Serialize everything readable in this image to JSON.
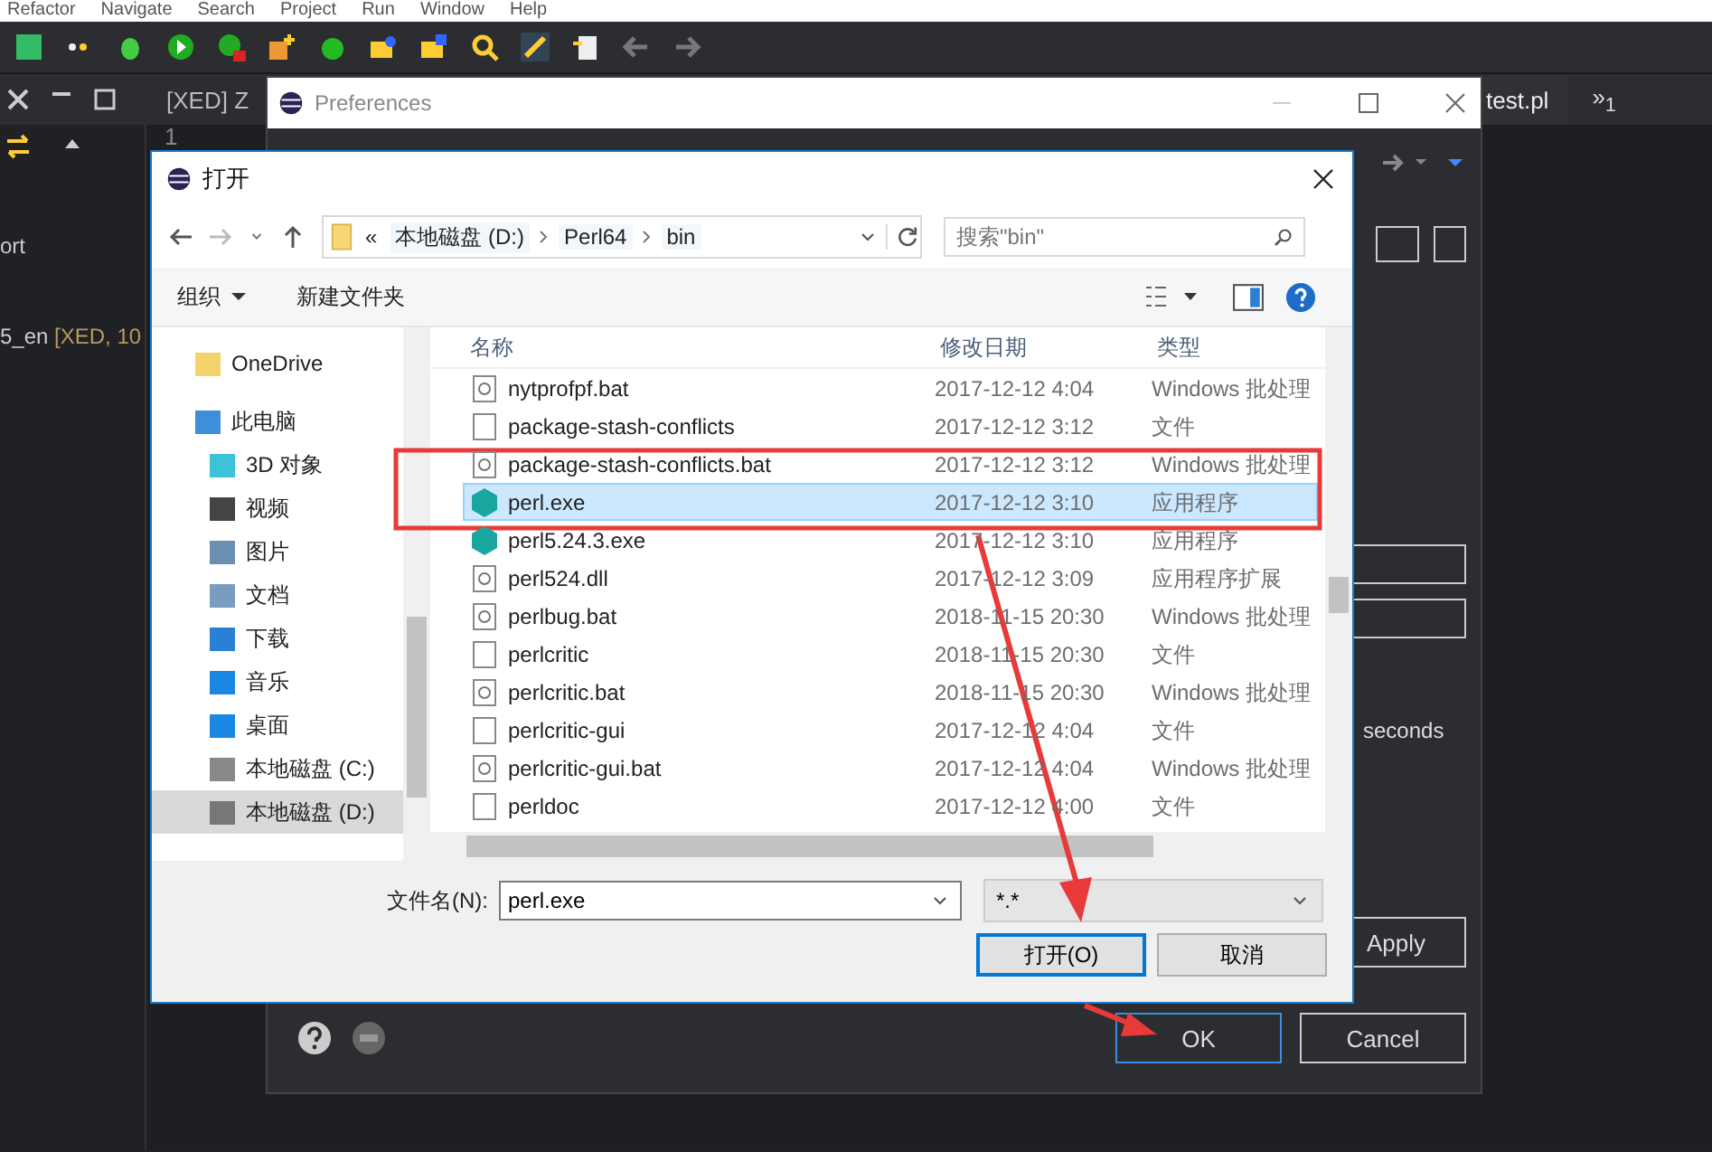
{
  "menu_bar": [
    "Refactor",
    "Navigate",
    "Search",
    "Project",
    "Run",
    "Window",
    "Help"
  ],
  "editor_tabs": [
    {
      "label": "[XED] Z",
      "selected": false
    },
    {
      "label": "test.pl",
      "selected": true
    }
  ],
  "overflow_tab": {
    "symbol": "»",
    "count": "1"
  },
  "outline": [
    {
      "text": "ort"
    },
    {
      "text": "5_en",
      "tag": "[XED, 10"
    }
  ],
  "line_number": "1",
  "preferences": {
    "title": "Preferences",
    "seconds_label": "seconds",
    "buttons": [
      {
        "label": "Apply",
        "default": false
      },
      {
        "label": "OK",
        "default": true
      },
      {
        "label": "Cancel",
        "default": false
      }
    ]
  },
  "open_dialog": {
    "title": "打开",
    "breadcrumb": {
      "overflow": "«",
      "segments": [
        "本地磁盘 (D:)",
        "Perl64",
        "bin"
      ]
    },
    "search": {
      "placeholder": "搜索\"bin\""
    },
    "toolbar": [
      {
        "label": "组织",
        "dropdown": true
      },
      {
        "label": "新建文件夹",
        "dropdown": false
      }
    ],
    "nav": [
      {
        "label": "OneDrive",
        "kind": "folder",
        "selected": false
      },
      {
        "label": "此电脑",
        "kind": "pc",
        "selected": false,
        "children": [
          {
            "label": "3D 对象",
            "kind": "cube",
            "selected": false
          },
          {
            "label": "视频",
            "kind": "video",
            "selected": false
          },
          {
            "label": "图片",
            "kind": "picture",
            "selected": false
          },
          {
            "label": "文档",
            "kind": "document",
            "selected": false
          },
          {
            "label": "下载",
            "kind": "download",
            "selected": false
          },
          {
            "label": "音乐",
            "kind": "music",
            "selected": false
          },
          {
            "label": "桌面",
            "kind": "desktop",
            "selected": false
          },
          {
            "label": "本地磁盘 (C:)",
            "kind": "drive-c",
            "selected": false
          },
          {
            "label": "本地磁盘 (D:)",
            "kind": "drive",
            "selected": true
          }
        ]
      }
    ],
    "columns": [
      "名称",
      "修改日期",
      "类型"
    ],
    "rows": [
      {
        "name": "nytprofpf.bat",
        "date": "2017-12-12 4:04",
        "type": "Windows 批处理",
        "kind": "bat",
        "selected": false
      },
      {
        "name": "package-stash-conflicts",
        "date": "2017-12-12 3:12",
        "type": "文件",
        "kind": "file",
        "selected": false
      },
      {
        "name": "package-stash-conflicts.bat",
        "date": "2017-12-12 3:12",
        "type": "Windows 批处理",
        "kind": "bat",
        "selected": false
      },
      {
        "name": "perl.exe",
        "date": "2017-12-12 3:10",
        "type": "应用程序",
        "kind": "exe",
        "selected": true
      },
      {
        "name": "perl5.24.3.exe",
        "date": "2017-12-12 3:10",
        "type": "应用程序",
        "kind": "exe",
        "selected": false
      },
      {
        "name": "perl524.dll",
        "date": "2017-12-12 3:09",
        "type": "应用程序扩展",
        "kind": "dll",
        "selected": false
      },
      {
        "name": "perlbug.bat",
        "date": "2018-11-15 20:30",
        "type": "Windows 批处理",
        "kind": "bat",
        "selected": false
      },
      {
        "name": "perlcritic",
        "date": "2018-11-15 20:30",
        "type": "文件",
        "kind": "file",
        "selected": false
      },
      {
        "name": "perlcritic.bat",
        "date": "2018-11-15 20:30",
        "type": "Windows 批处理",
        "kind": "bat",
        "selected": false
      },
      {
        "name": "perlcritic-gui",
        "date": "2017-12-12 4:04",
        "type": "文件",
        "kind": "file",
        "selected": false
      },
      {
        "name": "perlcritic-gui.bat",
        "date": "2017-12-12 4:04",
        "type": "Windows 批处理",
        "kind": "bat",
        "selected": false
      },
      {
        "name": "perldoc",
        "date": "2017-12-12 4:00",
        "type": "文件",
        "kind": "file",
        "selected": false
      }
    ],
    "filename": {
      "label": "文件名(N):",
      "value": "perl.exe"
    },
    "filter": {
      "value": "*.*"
    },
    "buttons": [
      {
        "label": "打开(O)",
        "default": true
      },
      {
        "label": "取消",
        "default": false
      }
    ]
  }
}
